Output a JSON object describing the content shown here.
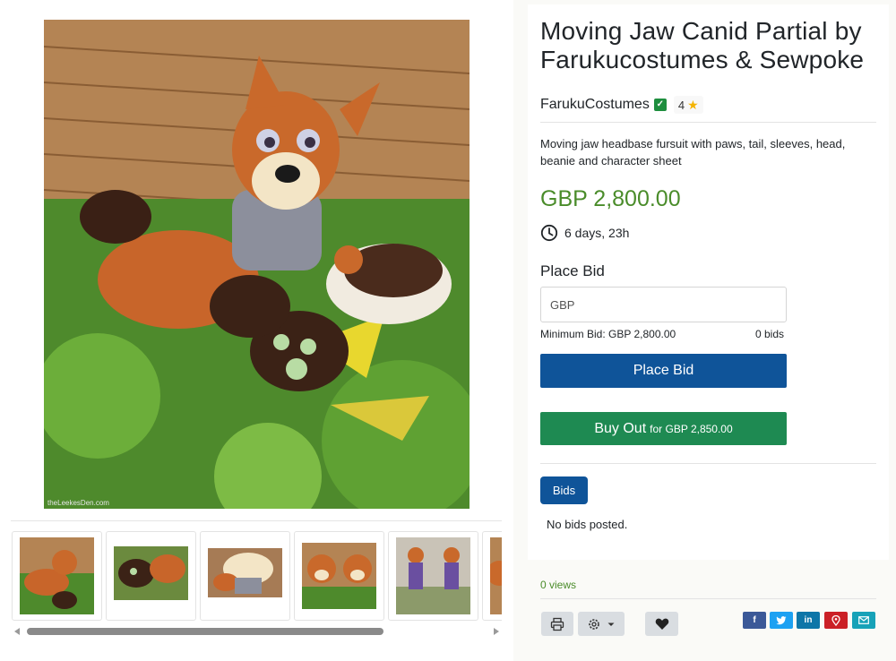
{
  "listing": {
    "title": "Moving Jaw Canid Partial by Farukucostumes & Sewpoke",
    "seller": "FarukuCostumes",
    "rating": "4",
    "description": "Moving jaw headbase fursuit with paws, tail, sleeves, head, beanie and character sheet",
    "price": "GBP 2,800.00",
    "time_left": "6 days, 23h",
    "watermark": "theLeekesDen.com"
  },
  "bid": {
    "heading": "Place Bid",
    "placeholder": "GBP",
    "minimum": "Minimum Bid: GBP 2,800.00",
    "count": "0 bids",
    "place_button": "Place Bid",
    "buyout_label": "Buy Out",
    "buyout_detail": "for GBP 2,850.00"
  },
  "bids_section": {
    "tab": "Bids",
    "empty": "No bids posted."
  },
  "footer": {
    "views": "0 views"
  },
  "icons": {
    "verified": "verified-check-icon",
    "star": "star-icon",
    "clock": "clock-icon",
    "print": "printer-icon",
    "settings": "gear-icon",
    "favorite": "heart-icon",
    "share": [
      "facebook-icon",
      "twitter-icon",
      "linkedin-icon",
      "pinterest-icon",
      "email-icon"
    ]
  },
  "colors": {
    "primary": "#0f5499",
    "success": "#1e8a52",
    "price": "#4a8c2a",
    "facebook": "#3b5998",
    "twitter": "#1da1f2",
    "linkedin": "#0e76a8",
    "pinterest": "#cb2027",
    "email": "#17a2b8"
  }
}
